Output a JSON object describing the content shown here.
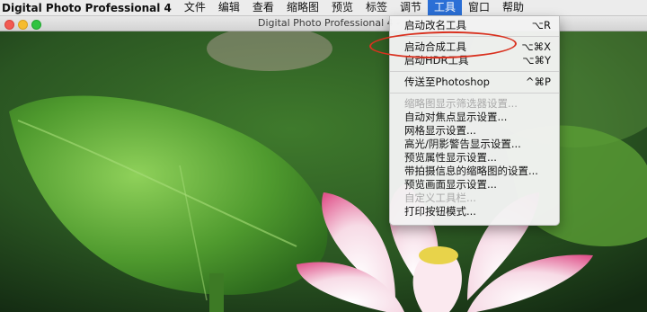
{
  "menubar": {
    "app_name": "Digital Photo Professional 4",
    "items": [
      "文件",
      "编辑",
      "查看",
      "缩略图",
      "预览",
      "标签",
      "调节",
      "工具",
      "窗口",
      "帮助"
    ]
  },
  "window": {
    "title": "Digital Photo Professional 4 -"
  },
  "tools_menu": {
    "items": [
      {
        "label": "启动改名工具",
        "shortcut": "⌥R",
        "enabled": true
      },
      {
        "label": "启动合成工具",
        "shortcut": "⌥⌘X",
        "enabled": true
      },
      {
        "label": "启动HDR工具",
        "shortcut": "⌥⌘Y",
        "enabled": true
      },
      {
        "label": "传送至Photoshop",
        "shortcut": "^⌘P",
        "enabled": true
      },
      {
        "label": "缩略图显示筛选器设置...",
        "shortcut": "",
        "enabled": false
      },
      {
        "label": "自动对焦点显示设置...",
        "shortcut": "",
        "enabled": true
      },
      {
        "label": "网格显示设置...",
        "shortcut": "",
        "enabled": true
      },
      {
        "label": "高光/阴影警告显示设置...",
        "shortcut": "",
        "enabled": true
      },
      {
        "label": "预览属性显示设置...",
        "shortcut": "",
        "enabled": true
      },
      {
        "label": "带拍摄信息的缩略图的设置...",
        "shortcut": "",
        "enabled": true
      },
      {
        "label": "预览画面显示设置...",
        "shortcut": "",
        "enabled": true
      },
      {
        "label": "自定义工具栏...",
        "shortcut": "",
        "enabled": false
      },
      {
        "label": "打印按钮模式...",
        "shortcut": "",
        "enabled": true
      }
    ]
  },
  "colors": {
    "menu_highlight": "#2b6fd6",
    "annotation_ring": "#d9311f"
  }
}
